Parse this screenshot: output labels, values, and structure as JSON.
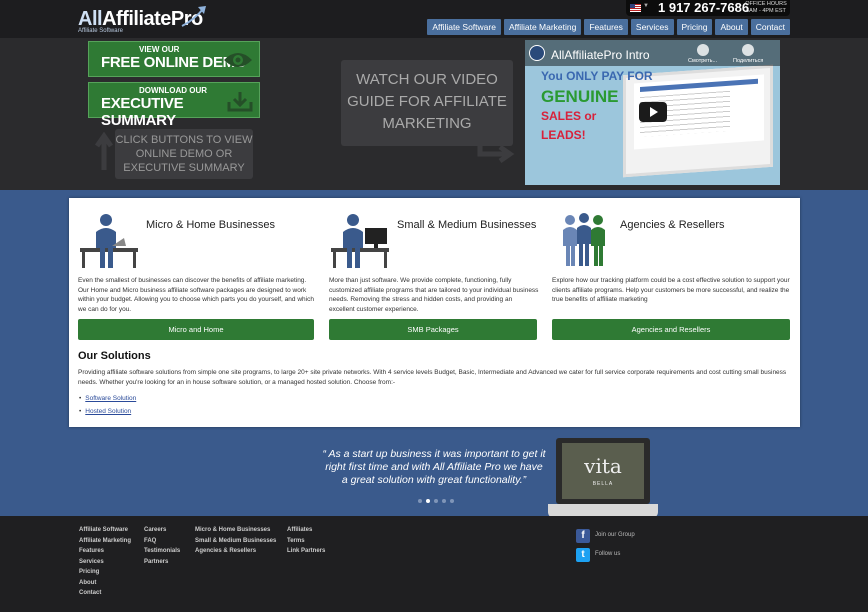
{
  "header": {
    "logo_name_a": "All",
    "logo_name_b": "AffiliatePro",
    "logo_tagline": "Affiliate Software",
    "phone": "1 917 267-7686",
    "hours_line1": "OFFICE HOURS",
    "hours_line2": "8AM - 4PM EST",
    "nav": [
      "Affiliate Software",
      "Affiliate Marketing",
      "Features",
      "Services",
      "Pricing",
      "About",
      "Contact"
    ]
  },
  "hero": {
    "demo_line1": "VIEW OUR",
    "demo_line2": "FREE ONLINE DEMO",
    "summary_line1": "DOWNLOAD OUR",
    "summary_line2": "EXECUTIVE SUMMARY",
    "click_text": "CLICK BUTTONS TO VIEW ONLINE DEMO OR EXECUTIVE SUMMARY",
    "watch_text": "WATCH OUR VIDEO GUIDE FOR AFFILIATE MARKETING"
  },
  "video": {
    "title": "AllAffiliatePro Intro",
    "action_watch": "Смотреть...",
    "action_share": "Поделиться",
    "line1": "You ONLY PAY FOR",
    "line2": "GENUINE",
    "line3": "SALES or",
    "line4": "LEADS!"
  },
  "columns": [
    {
      "title": "Micro & Home Businesses",
      "text": "Even the smallest of businesses can discover the benefits of affiliate marketing. Our Home and Micro business affiliate software packages are designed to work within your budget. Allowing you to choose which parts you do yourself, and which we can do for you.",
      "button": "Micro and Home"
    },
    {
      "title": "Small & Medium Businesses",
      "text": "More than just software. We provide complete, functioning, fully customized affiliate programs that are tailored to your individual business needs. Removing the stress and hidden costs, and providing an excellent customer experience.",
      "button": "SMB Packages"
    },
    {
      "title": "Agencies & Resellers",
      "text": "Explore how our tracking platform could be a cost effective solution to support your clients affiliate programs. Help your customers be more successful, and realize the true benefits of affiliate marketing",
      "button": "Agencies and Resellers"
    }
  ],
  "solutions": {
    "title": "Our Solutions",
    "text": "Providing affiliate software solutions from simple one site programs, to large 20+ site private networks. With 4 service levels Budget, Basic, Intermediate and Advanced we cater for full service corporate requirements and cost cutting small business needs. Whether you're looking for an in house software solution, or a managed hosted solution. Choose from:-",
    "links": [
      "Software Solution",
      "Hosted Solution"
    ]
  },
  "testimonial": {
    "quote": "“ As a start up business it was important to get it right first time and with All Affiliate Pro we have a great solution with great functionality.”",
    "brand": "vita",
    "brand_sub": "BELLA"
  },
  "footer": {
    "col1": [
      "Affiliate Software",
      "Affiliate Marketing",
      "Features",
      "Services",
      "Pricing",
      "About",
      "Contact"
    ],
    "col2": [
      "Careers",
      "FAQ",
      "Testimonials",
      "Partners"
    ],
    "col3": [
      "Micro & Home Businesses",
      "Small & Medium Businesses",
      "Agencies & Resellers"
    ],
    "col4": [
      "Affiliates",
      "Terms",
      "Link Partners"
    ],
    "facebook": "Join our Group",
    "twitter": "Follow us"
  },
  "colors": {
    "page_bg": "#3a5a8c",
    "header_bg": "#1d1d1f",
    "green_button": "#2f7a34",
    "nav_button": "#4a6f9d",
    "facebook": "#3b5998",
    "twitter": "#1da1f2"
  }
}
